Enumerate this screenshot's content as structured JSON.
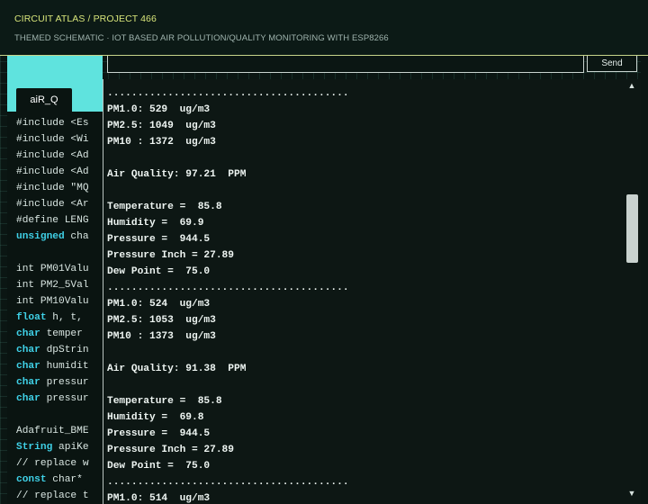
{
  "header": {
    "breadcrumb": "CIRCUIT ATLAS / PROJECT 466",
    "subtitle": "THEMED SCHEMATIC · IOT BASED AIR POLLUTION/QUALITY MONITORING WITH ESP8266"
  },
  "ide": {
    "tab_label": "aiR_Q",
    "code_lines": [
      {
        "text": "#include <Es",
        "kw": false
      },
      {
        "text": "#include <Wi",
        "kw": false
      },
      {
        "text": "#include <Ad",
        "kw": false
      },
      {
        "text": "#include <Ad",
        "kw": false
      },
      {
        "text": "#include \"MQ",
        "kw": false
      },
      {
        "text": "#include <Ar",
        "kw": false
      },
      {
        "text": "#define LENG",
        "kw": false
      },
      {
        "text": "unsigned cha",
        "kw": true
      },
      {
        "text": "",
        "kw": false
      },
      {
        "text": "int PM01Valu",
        "kw": false
      },
      {
        "text": "int PM2_5Val",
        "kw": false
      },
      {
        "text": "int PM10Valu",
        "kw": false
      },
      {
        "text": "float h, t,",
        "kw": true
      },
      {
        "text": "char temper",
        "kw": true
      },
      {
        "text": "char dpStrin",
        "kw": true
      },
      {
        "text": "char humidit",
        "kw": true
      },
      {
        "text": "char pressur",
        "kw": true
      },
      {
        "text": "char pressur",
        "kw": true
      },
      {
        "text": "",
        "kw": false
      },
      {
        "text": "Adafruit_BME",
        "kw": false
      },
      {
        "text": "String apiKe",
        "kw": true
      },
      {
        "text": "// replace w",
        "kw": false
      },
      {
        "text": "const char*",
        "kw": true
      },
      {
        "text": "// replace t",
        "kw": false
      }
    ]
  },
  "monitor": {
    "send_label": "Send",
    "scroll_up_icon": "▲",
    "scroll_down_icon": "▼",
    "lines": [
      "........................................",
      "PM1.0: 529  ug/m3",
      "PM2.5: 1049  ug/m3",
      "PM10 : 1372  ug/m3",
      "",
      "Air Quality: 97.21  PPM",
      "",
      "Temperature =  85.8",
      "Humidity =  69.9",
      "Pressure =  944.5",
      "Pressure Inch = 27.89",
      "Dew Point =  75.0",
      "........................................",
      "PM1.0: 524  ug/m3",
      "PM2.5: 1053  ug/m3",
      "PM10 : 1373  ug/m3",
      "",
      "Air Quality: 91.38  PPM",
      "",
      "Temperature =  85.8",
      "Humidity =  69.8",
      "Pressure =  944.5",
      "Pressure Inch = 27.89",
      "Dew Point =  75.0",
      "........................................",
      "PM1.0: 514  ug/m3"
    ]
  },
  "colors": {
    "accent_lime": "#d8e57a",
    "ide_cyan": "#5fe3de",
    "keyword_blue": "#3fd0e6",
    "background": "#0b1613"
  }
}
